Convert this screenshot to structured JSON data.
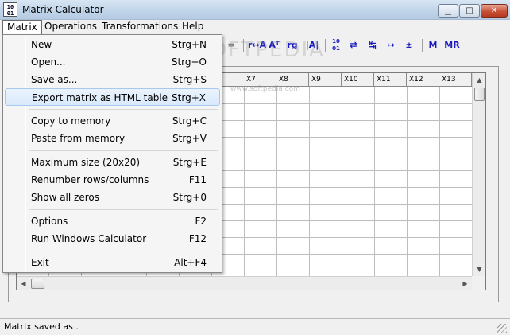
{
  "window": {
    "title": "Matrix Calculator",
    "icon_text": "10 01"
  },
  "menubar": {
    "items": [
      "Matrix",
      "Operations",
      "Transformations",
      "Help"
    ]
  },
  "toolbar": {
    "buttons": [
      "=",
      "r↔A",
      "Aᵀ",
      "rg",
      "|A|",
      "10 01",
      "⇄",
      "↹",
      "↦",
      "±",
      "M",
      "MR"
    ]
  },
  "grid": {
    "columns": [
      "X7",
      "X8",
      "X9",
      "X10",
      "X11",
      "X12",
      "X13"
    ]
  },
  "dropdown": {
    "items": [
      {
        "label": "New",
        "shortcut": "Strg+N"
      },
      {
        "label": "Open...",
        "shortcut": "Strg+O"
      },
      {
        "label": "Save as...",
        "shortcut": "Strg+S"
      },
      {
        "label": "Export matrix as HTML table",
        "shortcut": "Strg+X",
        "highlighted": true
      },
      {
        "label": "Copy to memory",
        "shortcut": "Strg+C"
      },
      {
        "label": "Paste from memory",
        "shortcut": "Strg+V"
      },
      {
        "label": "Maximum size (20x20)",
        "shortcut": "Strg+E"
      },
      {
        "label": "Renumber rows/columns",
        "shortcut": "F11"
      },
      {
        "label": "Show all zeros",
        "shortcut": "Strg+0"
      },
      {
        "label": "Options",
        "shortcut": "F2"
      },
      {
        "label": "Run Windows Calculator",
        "shortcut": "F12"
      },
      {
        "label": "Exit",
        "shortcut": "Alt+F4"
      }
    ]
  },
  "watermark": {
    "text": "SOFTPEDIA",
    "url": "www.softpedia.com"
  },
  "statusbar": {
    "text": "Matrix saved as ."
  }
}
